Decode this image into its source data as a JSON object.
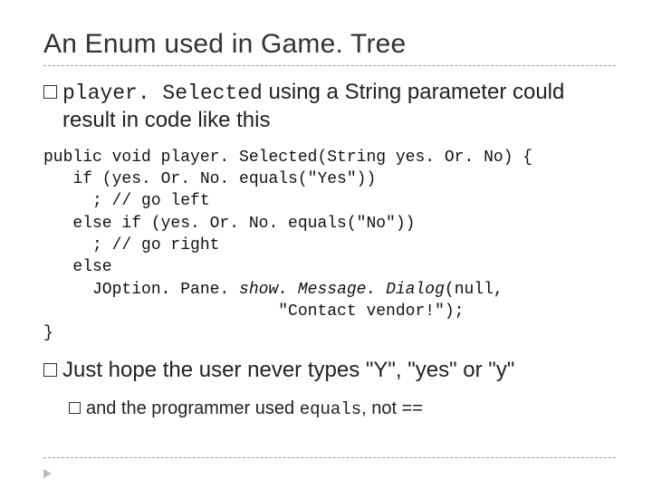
{
  "title": "An Enum used in Game. Tree",
  "bullet1": {
    "code": "player. Selected",
    "rest": " using a String parameter could result in code like this"
  },
  "code": {
    "l1a": "public void player. Selected(String yes. Or. No) {",
    "l2a": "   if (yes. Or. No. equals(\"Yes\"))",
    "l3a": "     ; // go left",
    "l4a": "   else if (yes. Or. No. equals(\"No\"))",
    "l5a": "     ; // go right",
    "l6a": "   else",
    "l7a": "     JOption. Pane. ",
    "l7b": "show. Message. Dialog",
    "l7c": "(null,",
    "l8a": "                        \"Contact vendor!\");",
    "l9a": "}"
  },
  "bullet2": {
    "text": "Just hope the user never types \"Y\", \"yes\" or \"y\""
  },
  "sub": {
    "a": "and the programmer used ",
    "b": "equals",
    "c": ", not =="
  }
}
